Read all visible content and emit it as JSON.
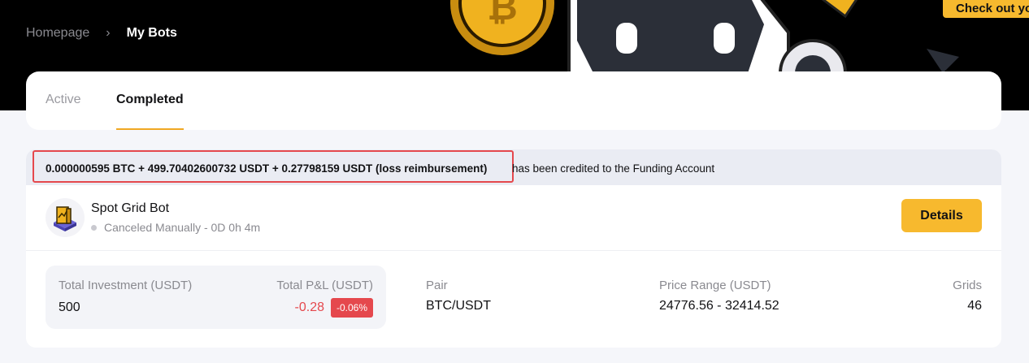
{
  "breadcrumb": {
    "home": "Homepage",
    "separator": "›",
    "current": "My Bots"
  },
  "hero": {
    "cta_label": "Check out yo"
  },
  "tabs": [
    {
      "label": "Active",
      "selected": false
    },
    {
      "label": "Completed",
      "selected": true
    }
  ],
  "notice": {
    "amount": "0.000000595 BTC + 499.70402600732 USDT + 0.27798159 USDT (loss reimbursement)",
    "message": "has been credited to the Funding Account"
  },
  "bot": {
    "icon": "spot-grid-bot-icon",
    "name": "Spot Grid Bot",
    "status": "Canceled Manually - 0D 0h 4m",
    "details_label": "Details",
    "total_investment_label": "Total Investment (USDT)",
    "total_investment_value": "500",
    "total_pnl_label": "Total P&L (USDT)",
    "total_pnl_value": "-0.28",
    "total_pnl_percent": "-0.06%",
    "pair_label": "Pair",
    "pair_value": "BTC/USDT",
    "price_range_label": "Price Range (USDT)",
    "price_range_value": "24776.56 - 32414.52",
    "grids_label": "Grids",
    "grids_value": "46"
  },
  "colors": {
    "accent": "#f7b92e",
    "tab_underline": "#f0a823",
    "negative": "#e5484d",
    "highlight_border": "#e5484d"
  }
}
